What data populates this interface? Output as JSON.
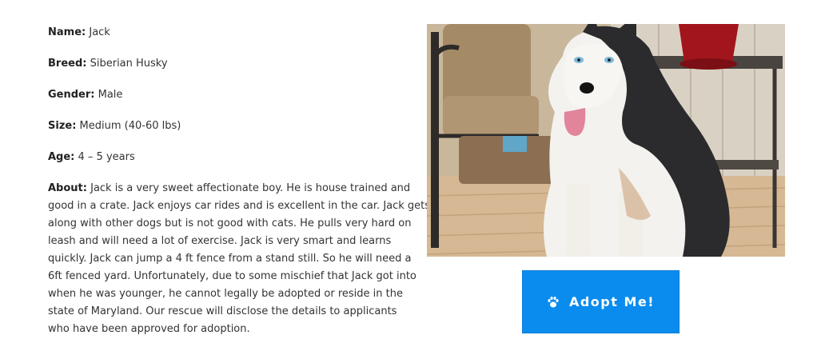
{
  "pet": {
    "name_label": "Name:",
    "name": "Jack",
    "breed_label": "Breed:",
    "breed": "Siberian Husky",
    "gender_label": "Gender:",
    "gender": "Male",
    "size_label": "Size:",
    "size": "Medium (40-60 lbs)",
    "age_label": "Age:",
    "age": "4 – 5 years",
    "about_label": "About:",
    "about_lines": [
      "Jack is a very sweet affectionate boy. He is house trained and",
      "good in a crate.  Jack enjoys car rides and is excellent in the car. Jack gets",
      "along with other dogs but is not good with cats. He pulls very hard on",
      "leash and will need a lot of exercise. Jack is very smart and learns",
      "quickly. Jack can jump a 4 ft fence from a stand still. So he will need a",
      "6ft fenced yard.  Unfortunately, due to some mischief that Jack got into",
      "when he was younger, he cannot legally be adopted or reside in the",
      "state of Maryland.  Our rescue will disclose the details to applicants",
      "who have been approved for adoption."
    ]
  },
  "photo": {
    "icon": "husky-dog-photo"
  },
  "adopt_button": {
    "label": "Adopt Me!",
    "icon": "paw-icon",
    "color": "#0a8cef"
  }
}
